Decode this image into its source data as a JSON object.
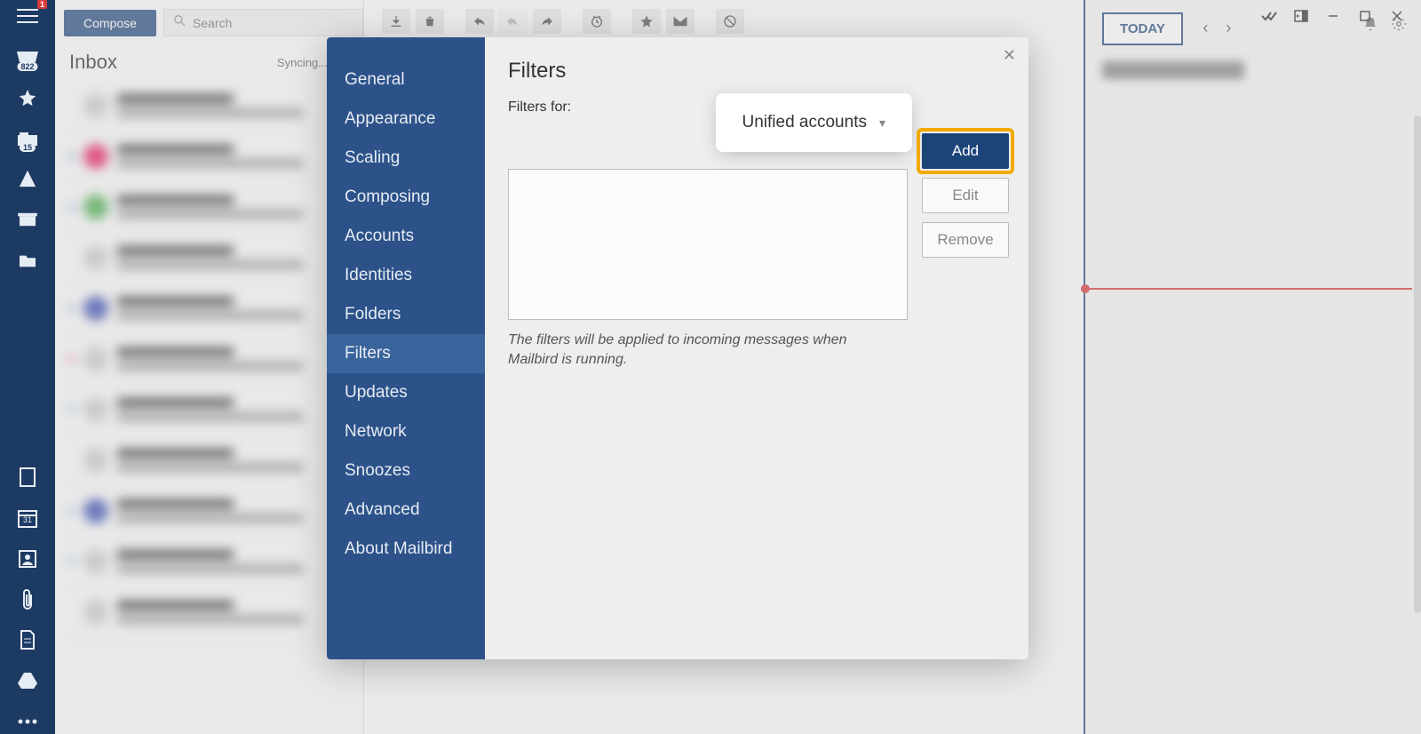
{
  "rail": {
    "menu_badge": "1",
    "inbox_count": "822",
    "flag_count": "15",
    "calendar_day": "31"
  },
  "toolbar": {
    "compose": "Compose",
    "search_placeholder": "Search"
  },
  "inbox": {
    "title": "Inbox",
    "syncing": "Syncing..."
  },
  "calendar": {
    "today": "TODAY"
  },
  "settings": {
    "items": [
      "General",
      "Appearance",
      "Scaling",
      "Composing",
      "Accounts",
      "Identities",
      "Folders",
      "Filters",
      "Updates",
      "Network",
      "Snoozes",
      "Advanced",
      "About Mailbird"
    ],
    "active_index": 7,
    "title": "Filters",
    "filters_for_label": "Filters for:",
    "account_selected": "Unified accounts",
    "add": "Add",
    "edit": "Edit",
    "remove": "Remove",
    "note": "The filters will be applied to incoming messages when Mailbird is running."
  }
}
